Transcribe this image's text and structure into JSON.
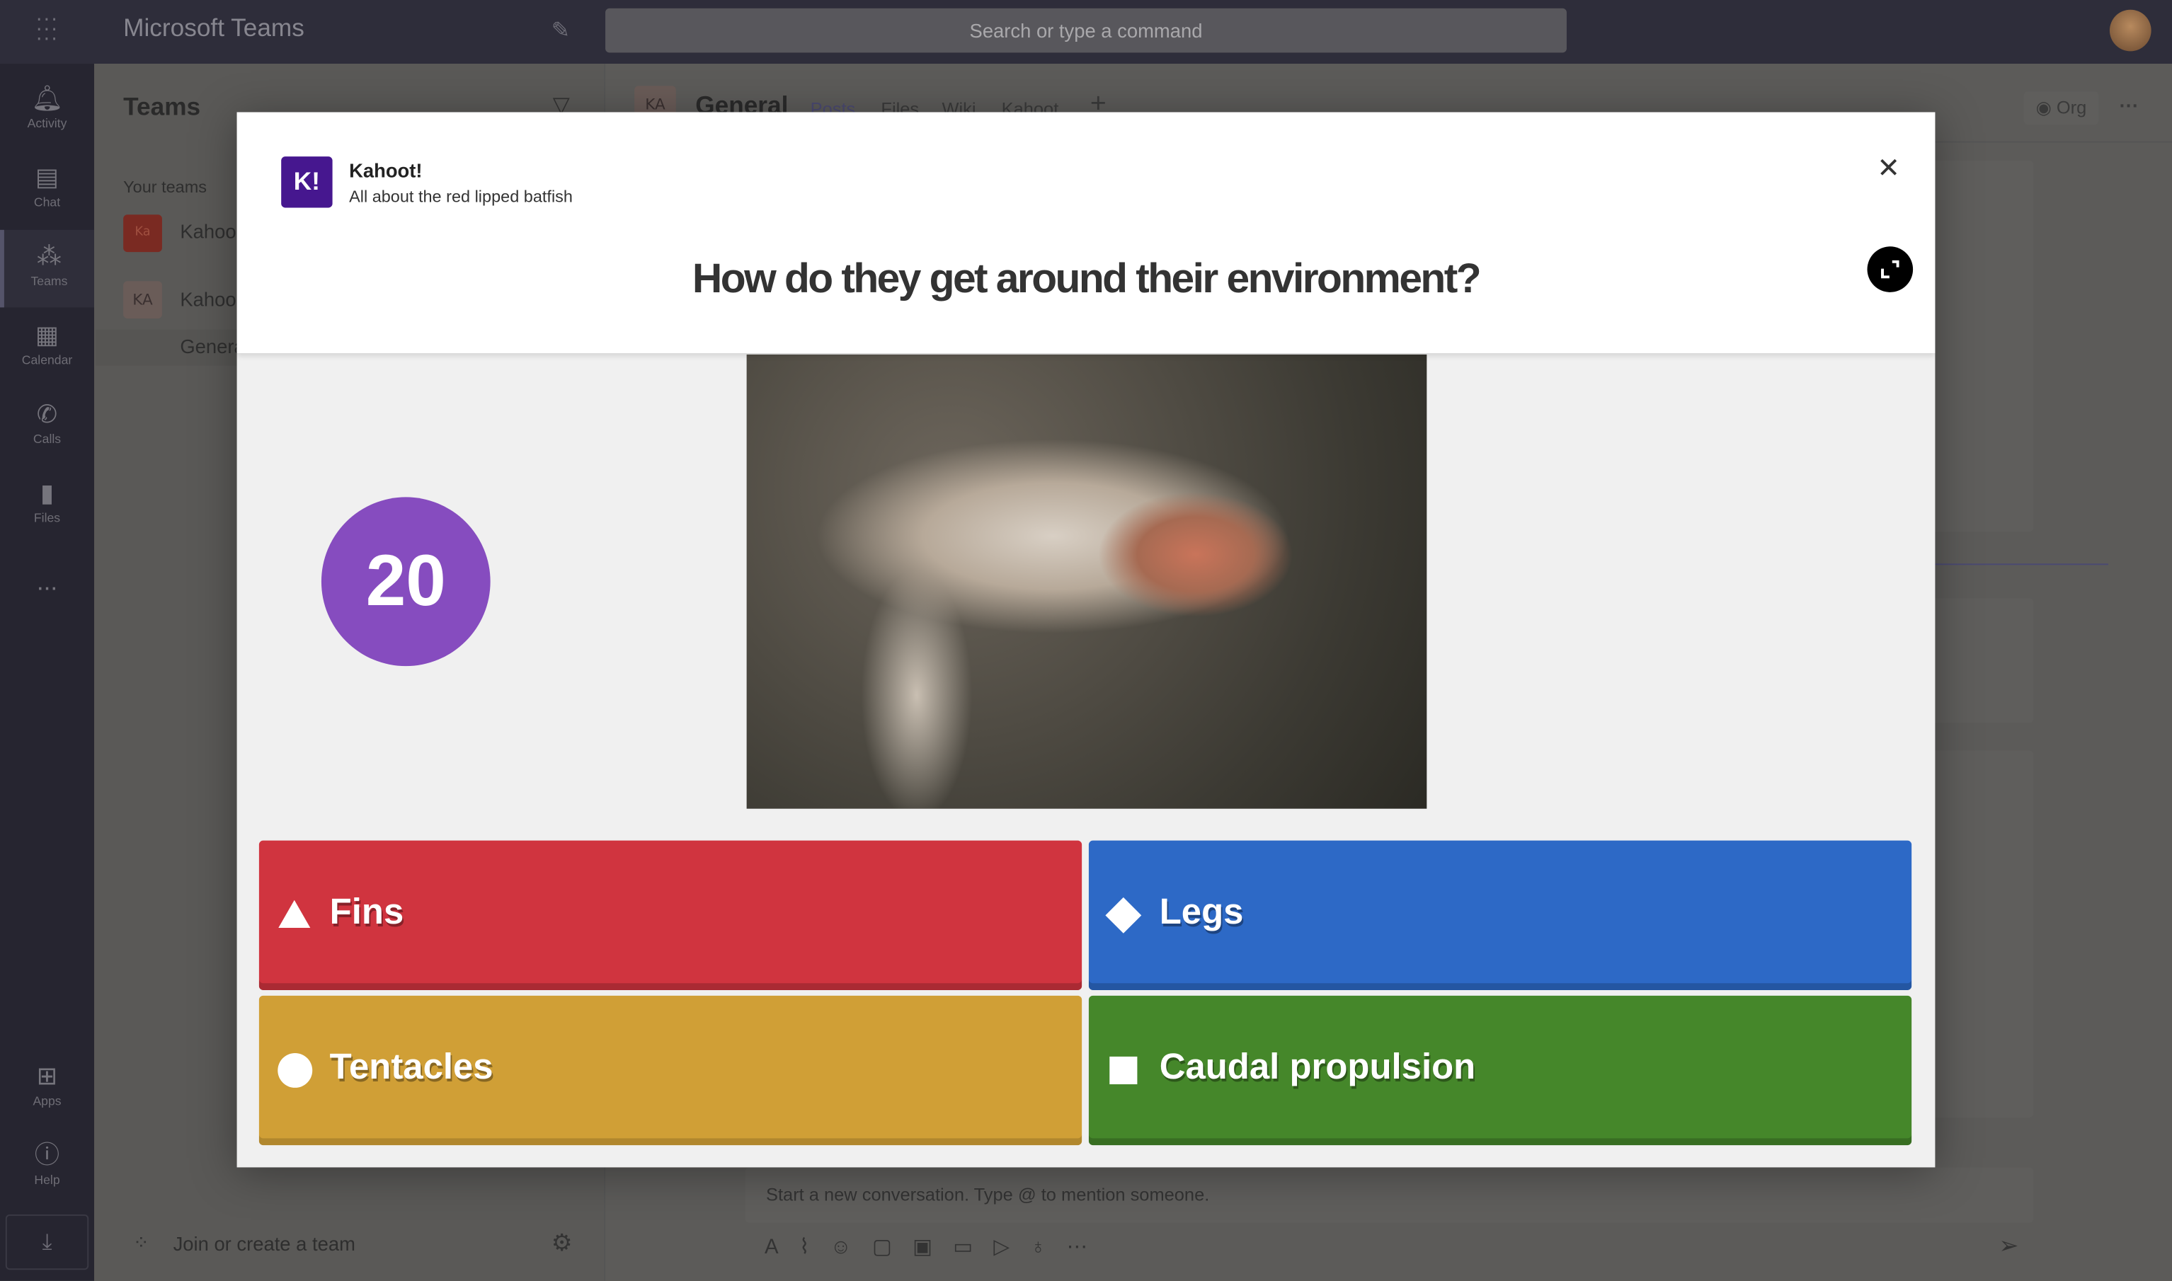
{
  "app": {
    "title": "Microsoft Teams",
    "search_placeholder": "Search or type a command"
  },
  "rail": {
    "items": [
      {
        "label": "Activity",
        "icon": "bell-icon"
      },
      {
        "label": "Chat",
        "icon": "chat-icon"
      },
      {
        "label": "Teams",
        "icon": "teams-icon",
        "selected": true
      },
      {
        "label": "Calendar",
        "icon": "calendar-icon"
      },
      {
        "label": "Calls",
        "icon": "phone-icon"
      },
      {
        "label": "Files",
        "icon": "file-icon"
      }
    ],
    "more": "...",
    "apps": "Apps",
    "help": "Help"
  },
  "sidebar": {
    "title": "Teams",
    "section": "Your teams",
    "teams": [
      {
        "initials": "Ka",
        "name": "Kahoo",
        "color": "#7a2a22"
      },
      {
        "initials": "KA",
        "name": "Kahoo",
        "color": "#6a5c58"
      }
    ],
    "channel": "Genera",
    "join": "Join or create a team"
  },
  "channel_header": {
    "initials": "KA",
    "name": "General",
    "tabs": [
      "Posts",
      "Files",
      "Wiki",
      "Kahoot",
      "+"
    ],
    "org": "Org",
    "more": "···"
  },
  "compose": {
    "placeholder": "Start a new conversation. Type @ to mention someone."
  },
  "modal": {
    "app_logo": "K!",
    "app_name": "Kahoot!",
    "subtitle": "All about the red lipped batfish",
    "question": "How do they get around their environment?",
    "timer": "20",
    "answers": [
      {
        "label": "Fins",
        "shape": "triangle",
        "color": "#d0343f"
      },
      {
        "label": "Legs",
        "shape": "diamond",
        "color": "#2d69c6"
      },
      {
        "label": "Tentacles",
        "shape": "circle",
        "color": "#d09f36"
      },
      {
        "label": "Caudal propulsion",
        "shape": "square",
        "color": "#45872a"
      }
    ]
  }
}
